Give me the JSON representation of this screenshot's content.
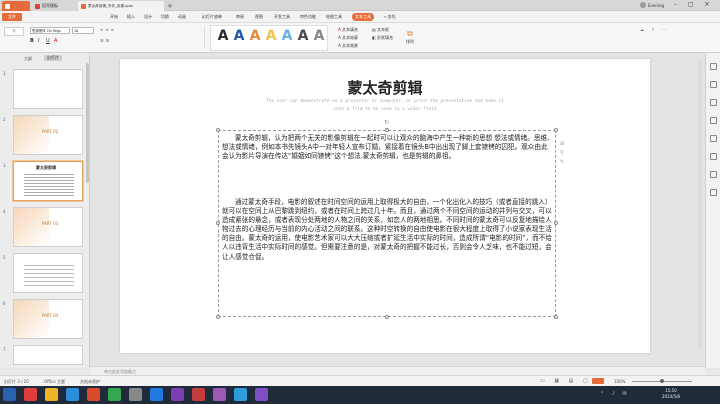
{
  "tabs": {
    "home": "稻壳模板",
    "doc": "蒙太奇剪辑_写作_讲课.pptx",
    "user": "Evening"
  },
  "menu": {
    "file": "文件",
    "items": [
      "开始",
      "插入",
      "设计",
      "切换",
      "动画",
      "幻灯片放映",
      "审阅",
      "视图",
      "开发工具",
      "特色功能",
      "绘图工具",
      "文本工具"
    ],
    "search": "查找"
  },
  "toolbar": {
    "font_name": "思源黑体 CN Regu",
    "font_size": "18",
    "text_fill": "文本填充",
    "text_outline": "文本轮廓",
    "text_effect": "文本效果",
    "text_box": "文本框",
    "shape_fill": "形状填充",
    "shape_outline": "形状轮廓",
    "arrange": "排列",
    "wordart_colors": [
      "#2a2a2a",
      "#1f5aa8",
      "#e58a3a",
      "#f0c44a",
      "#6bb0e0",
      "#4a4a4a",
      "#888888"
    ],
    "wordart_letter": "A"
  },
  "leftpane": {
    "tab_outline": "大纲",
    "tab_slides": "幻灯片",
    "thumbs": [
      {
        "num": "1",
        "label": "PART 01"
      },
      {
        "num": "2",
        "label": "PART 02"
      },
      {
        "num": "3",
        "label": "蒙太奇剪辑"
      },
      {
        "num": "4",
        "label": "PART 03"
      },
      {
        "num": "5",
        "label": ""
      },
      {
        "num": "6",
        "label": "PART 04"
      },
      {
        "num": "7",
        "label": ""
      }
    ]
  },
  "slide": {
    "title": "蒙太奇剪辑",
    "subtitle_line1": "The user can demonstrate on a projector or computer, or print the presentation and make it",
    "subtitle_line2": "into a film to be used in a wider field",
    "para1": "蒙太奇剪辑，认为把两个无关的影像剪辑在一起时可以让观众的脑海中产生一种新的思想 想法或情绪。思维、想法或情绪，例如本书先镜头A中一对年轻人宣布订婚，紧接着在镜头B中出出现了脚上套镣铐的囚犯。观众由此会认为影片导演在传达“婚姻如同镣铐”这个想法.蒙太奇剪辑，也是剪辑的鼻祖。",
    "para2": "通过蒙太奇手段，电影的叙述在时间空间的运用上取得极大的自由，一个化出化入的技巧（或者直接的跳入）就可以在空间上从巴黎跳到纽约，或者在时间上跨过几十年。而且，通过两个不同空间的运动的并列与交叉，可以造成紧张的悬念，或者表现分处两地的人物之间的关系，如恋人的两地相思。不同时间的蒙太奇可以反复地描绘人物过去的心理经历与当前的内心活动之间的联系。这种时空转换的自由使电影在很大程度上取得了小说家表现生活的自由。蒙太奇的运用，使电影艺术家可以大大压缩或者扩延生活中实际的时间，造成所谓“电影的时间”，而不给人以违背生活中实际时间的感觉。但需要注意的是，对蒙太奇的把握不能过长，否则会令人乏味，也不能过短，会让人感觉仓促。"
  },
  "notes": {
    "placeholder": "单击此处添加备注"
  },
  "status": {
    "slide_info": "幻灯片 3 / 20",
    "theme": "Office 主题",
    "doc_protect": "文档未保护",
    "zoom": "100%"
  },
  "clock": {
    "time": "15:50",
    "date": "2024/5/8"
  }
}
